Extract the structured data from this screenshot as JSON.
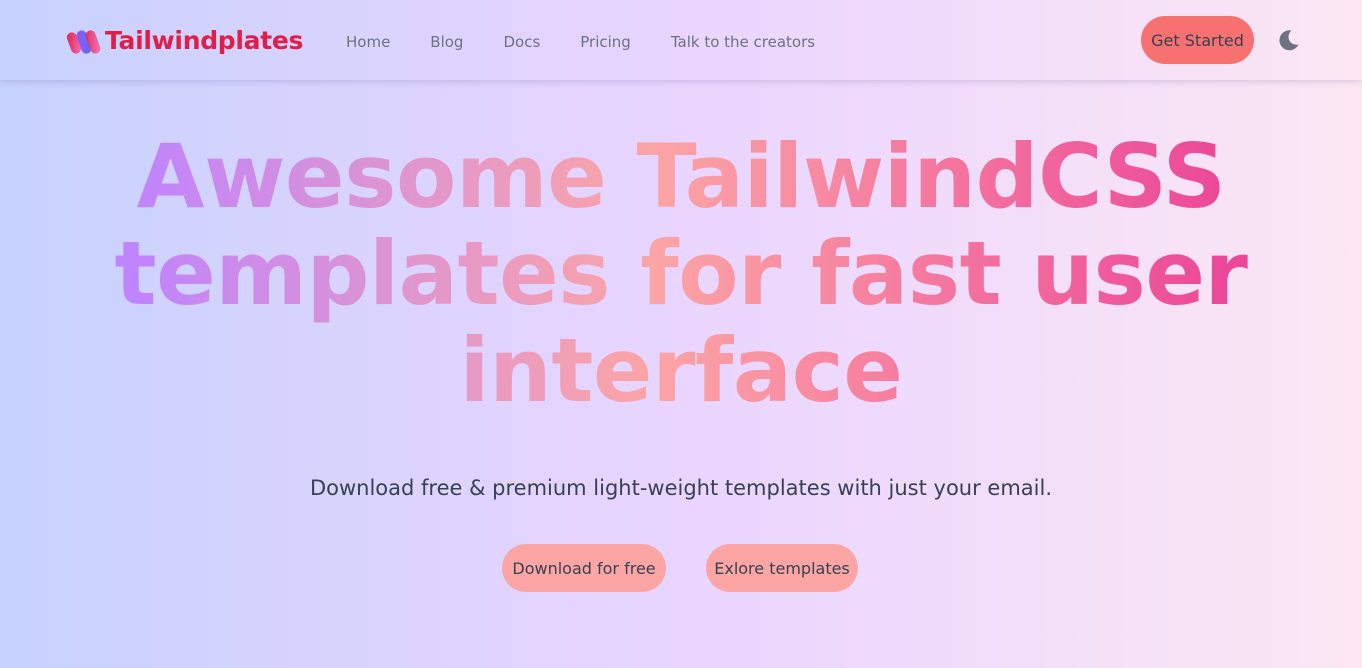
{
  "brand": {
    "name": "Tailwindplates",
    "logo_icon": "tailwindplates-logo-icon",
    "color": "#e11d48"
  },
  "nav": {
    "links": [
      "Home",
      "Blog",
      "Docs",
      "Pricing",
      "Talk to the creators"
    ],
    "get_started": "Get Started",
    "theme_icon": "moon-icon"
  },
  "hero": {
    "title_lines": [
      "Awesome TailwindCSS",
      "templates for fast user",
      "interface"
    ],
    "subtitle": "Download free & premium light-weight templates with just your email.",
    "primary_cta": "Download for free",
    "secondary_cta": "Exlore templates"
  },
  "colors": {
    "accent": "#f87171",
    "cta": "#fca5a5",
    "gradient_start": "#c084fc",
    "gradient_mid": "#fca5a5",
    "gradient_end": "#ec4899"
  }
}
